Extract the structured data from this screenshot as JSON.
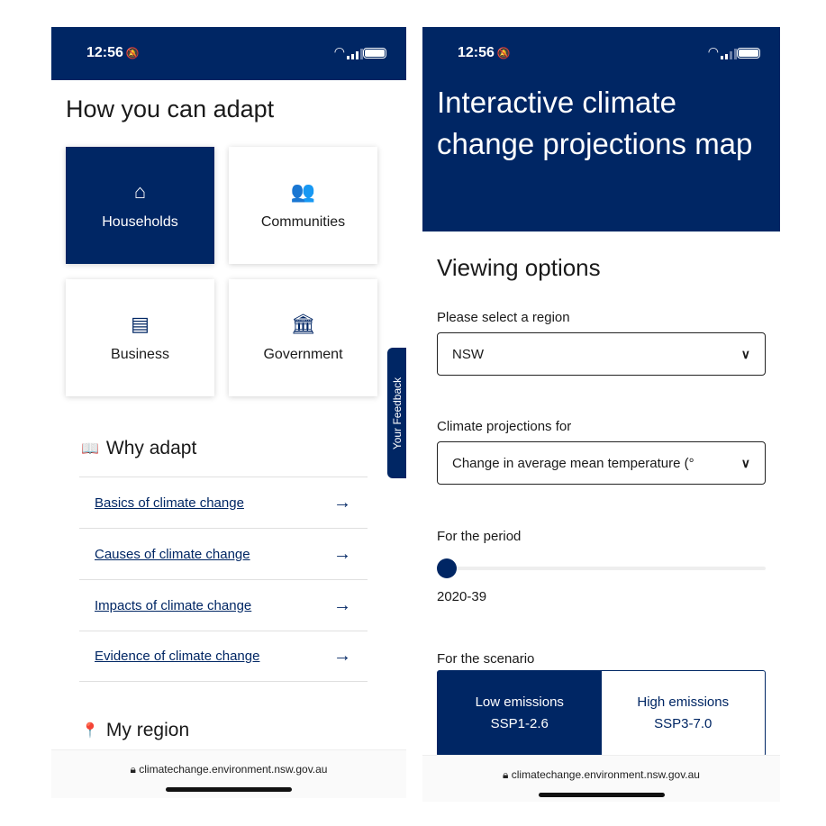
{
  "status": {
    "time": "12:56"
  },
  "left": {
    "title": "How you can adapt",
    "tiles": [
      {
        "label": "Households",
        "icon": "home-icon"
      },
      {
        "label": "Communities",
        "icon": "people-icon"
      },
      {
        "label": "Business",
        "icon": "store-icon"
      },
      {
        "label": "Government",
        "icon": "bank-icon"
      }
    ],
    "feedback": "Your Feedback",
    "why_adapt": "Why adapt",
    "links": [
      "Basics of climate change",
      "Causes of climate change",
      "Impacts of climate change",
      "Evidence of climate change"
    ],
    "my_region": "My region",
    "url": "climatechange.environment.nsw.gov.au"
  },
  "right": {
    "hero": "Interactive climate change projections map",
    "viewing": "Viewing options",
    "region_label": "Please select a region",
    "region_value": "NSW",
    "proj_label": "Climate projections for",
    "proj_value": "Change in average mean temperature (°",
    "period_label": "For the period",
    "period_value": "2020-39",
    "period_slider_position": 0,
    "scenario_label": "For the scenario",
    "scenarios": [
      {
        "name": "Low emissions",
        "code": "SSP1-2.6",
        "selected": true
      },
      {
        "name": "High emissions",
        "code": "SSP3-7.0",
        "selected": false
      }
    ],
    "url": "climatechange.environment.nsw.gov.au"
  },
  "colors": {
    "brand": "#002664"
  }
}
